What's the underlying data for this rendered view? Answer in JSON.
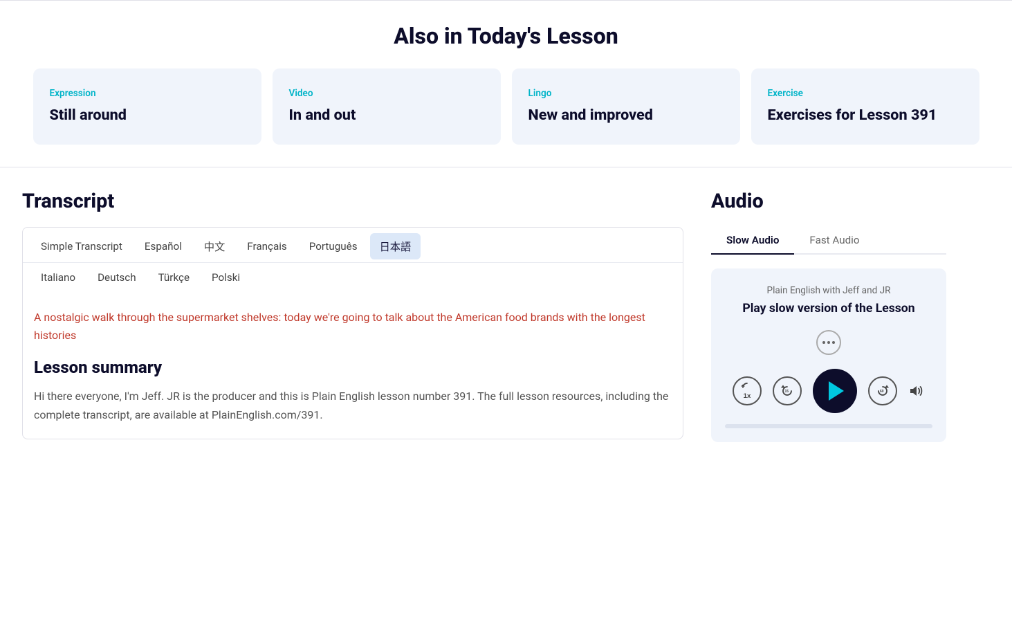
{
  "page": {
    "also_in_lesson_title": "Also in Today's Lesson",
    "top_divider": true
  },
  "cards": [
    {
      "id": "card-expression",
      "category": "Expression",
      "title": "Still around"
    },
    {
      "id": "card-video",
      "category": "Video",
      "title": "In and out"
    },
    {
      "id": "card-lingo",
      "category": "Lingo",
      "title": "New and improved"
    },
    {
      "id": "card-exercise",
      "category": "Exercise",
      "title": "Exercises for Lesson 391"
    }
  ],
  "transcript": {
    "heading": "Transcript",
    "tabs_row1": [
      {
        "id": "simple",
        "label": "Simple Transcript",
        "active": true
      },
      {
        "id": "espanol",
        "label": "Español",
        "active": false
      },
      {
        "id": "chinese",
        "label": "中文",
        "active": false
      },
      {
        "id": "francais",
        "label": "Français",
        "active": false
      },
      {
        "id": "portugues",
        "label": "Português",
        "active": false
      },
      {
        "id": "japanese",
        "label": "日本語",
        "active": true
      }
    ],
    "tabs_row2": [
      {
        "id": "italiano",
        "label": "Italiano",
        "active": false
      },
      {
        "id": "deutsch",
        "label": "Deutsch",
        "active": false
      },
      {
        "id": "turkce",
        "label": "Türkçe",
        "active": false
      },
      {
        "id": "polski",
        "label": "Polski",
        "active": false
      }
    ],
    "intro_text": "A nostalgic walk through the supermarket shelves: today we're going to talk about the American food brands with the longest histories",
    "lesson_summary_heading": "Lesson summary",
    "lesson_summary_text": "Hi there everyone, I'm Jeff. JR is the producer and this is Plain English lesson number 391. The full lesson resources, including the complete transcript, are available at PlainEnglish.com/391."
  },
  "audio": {
    "heading": "Audio",
    "tabs": [
      {
        "id": "slow",
        "label": "Slow Audio",
        "active": true
      },
      {
        "id": "fast",
        "label": "Fast Audio",
        "active": false
      }
    ],
    "player": {
      "subtitle": "Plain English with Jeff and JR",
      "title": "Play slow version of the Lesson",
      "menu_icon": "•••",
      "rewind_label": "1x",
      "back_label": "15",
      "forward_label": "60",
      "progress": 0
    }
  }
}
